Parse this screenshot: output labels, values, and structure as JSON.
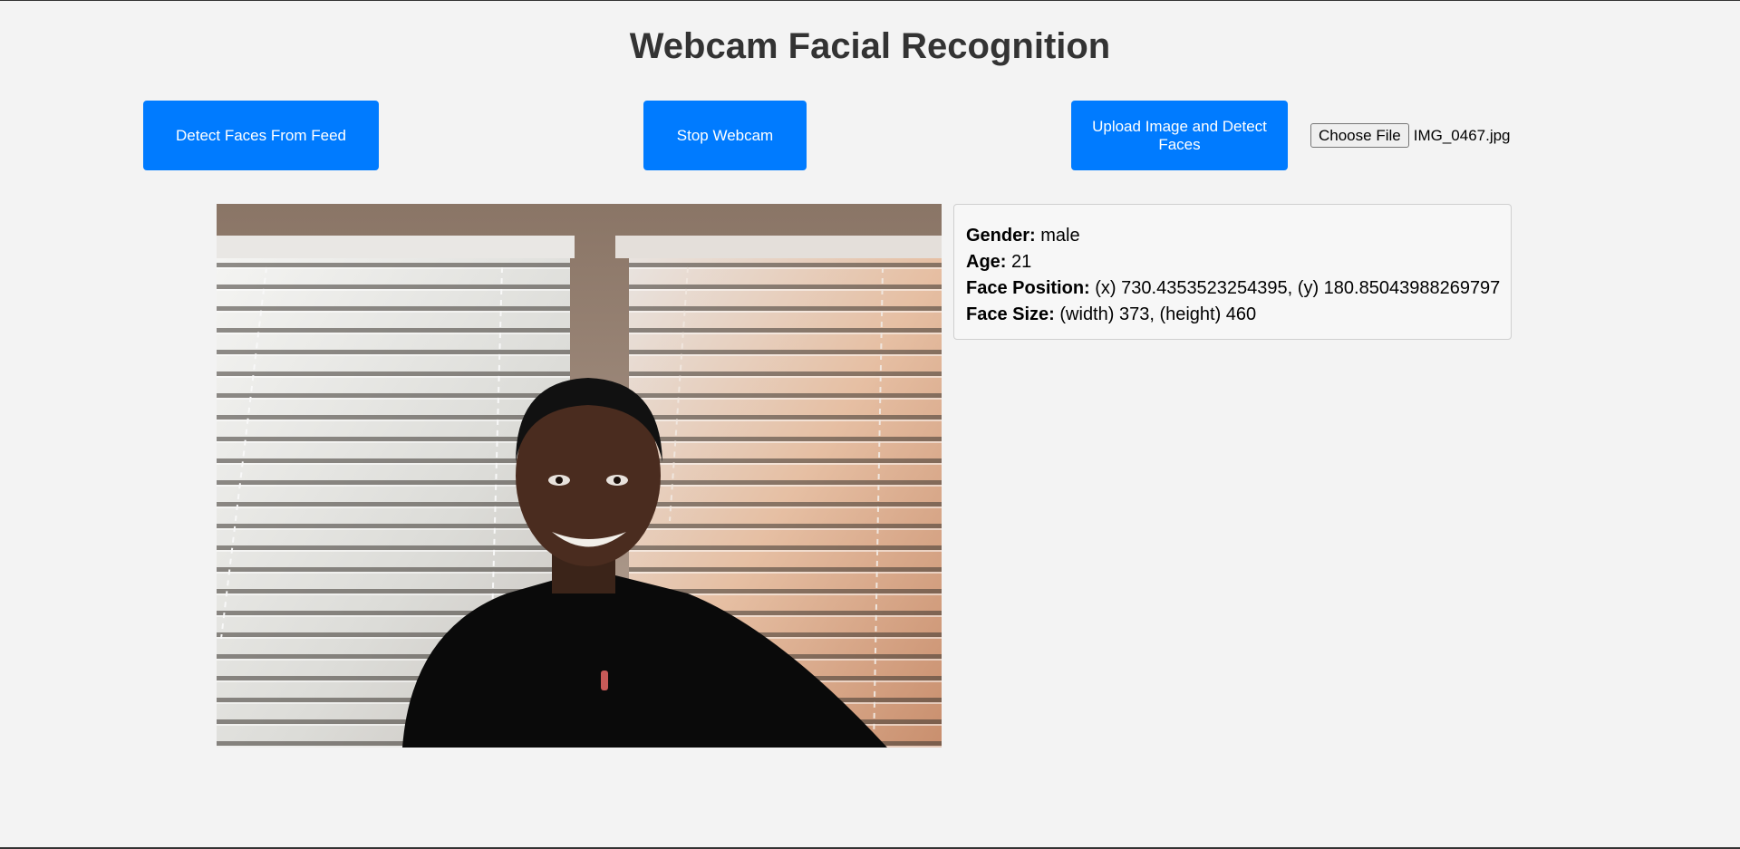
{
  "page": {
    "title": "Webcam Facial Recognition"
  },
  "controls": {
    "detect_button": "Detect Faces From Feed",
    "stop_button": "Stop Webcam",
    "upload_button": "Upload Image and Detect Faces",
    "file_chooser_button": "Choose File",
    "file_name": "IMG_0467.jpg"
  },
  "results": {
    "gender_label": "Gender:",
    "gender_value": "male",
    "age_label": "Age:",
    "age_value": "21",
    "position_label": "Face Position:",
    "position_value": "(x) 730.4353523254395, (y) 180.85043988269797",
    "size_label": "Face Size:",
    "size_value": "(width) 373, (height) 460"
  },
  "colors": {
    "accent": "#007bff",
    "page_background": "#f3f3f3",
    "title_text": "#333333"
  },
  "icons": {
    "video": "webcam-video-frame"
  }
}
